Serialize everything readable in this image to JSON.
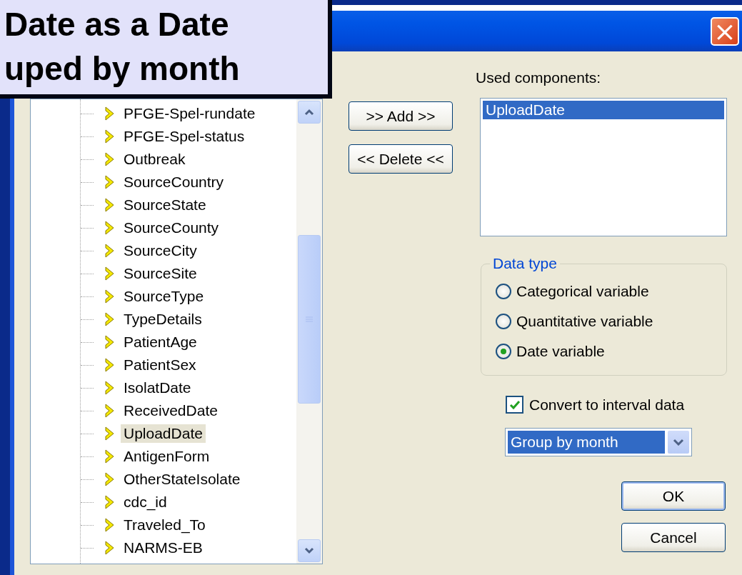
{
  "callout": {
    "lines": [
      "Date as a Date",
      "uped by month"
    ]
  },
  "window": {
    "close": "×"
  },
  "tree": {
    "items": [
      {
        "label": "PFGE-Spel-rundate",
        "selected": false
      },
      {
        "label": "PFGE-Spel-status",
        "selected": false
      },
      {
        "label": "Outbreak",
        "selected": false
      },
      {
        "label": "SourceCountry",
        "selected": false
      },
      {
        "label": "SourceState",
        "selected": false
      },
      {
        "label": "SourceCounty",
        "selected": false
      },
      {
        "label": "SourceCity",
        "selected": false
      },
      {
        "label": "SourceSite",
        "selected": false
      },
      {
        "label": "SourceType",
        "selected": false
      },
      {
        "label": "TypeDetails",
        "selected": false
      },
      {
        "label": "PatientAge",
        "selected": false
      },
      {
        "label": "PatientSex",
        "selected": false
      },
      {
        "label": "IsolatDate",
        "selected": false
      },
      {
        "label": "ReceivedDate",
        "selected": false
      },
      {
        "label": "UploadDate",
        "selected": true
      },
      {
        "label": "AntigenForm",
        "selected": false
      },
      {
        "label": "OtherStateIsolate",
        "selected": false
      },
      {
        "label": "cdc_id",
        "selected": false
      },
      {
        "label": "Traveled_To",
        "selected": false
      },
      {
        "label": "NARMS-EB",
        "selected": false
      }
    ]
  },
  "buttons": {
    "add": ">> Add >>",
    "delete": "<< Delete <<"
  },
  "used_components": {
    "label": "Used components:",
    "items": [
      {
        "label": "UploadDate",
        "selected": true
      }
    ]
  },
  "data_type": {
    "legend": "Data type",
    "options": [
      {
        "label": "Categorical variable",
        "selected": false
      },
      {
        "label": "Quantitative variable",
        "selected": false
      },
      {
        "label": "Date variable",
        "selected": true
      }
    ]
  },
  "convert": {
    "label": "Convert to interval data",
    "checked": true
  },
  "grouping": {
    "value": "Group by month"
  },
  "actions": [
    "OK",
    "Cancel"
  ]
}
